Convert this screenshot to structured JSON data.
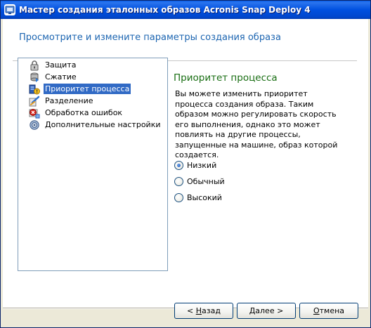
{
  "window": {
    "title": "Мастер создания эталонных образов Acronis Snap Deploy 4"
  },
  "header": {
    "title": "Просмотрите и измените параметры создания образа"
  },
  "tree": {
    "items": [
      {
        "label": "Защита",
        "icon": "lock-icon",
        "selected": false
      },
      {
        "label": "Сжатие",
        "icon": "compression-icon",
        "selected": false
      },
      {
        "label": "Приоритет процесса",
        "icon": "priority-icon",
        "selected": true
      },
      {
        "label": "Разделение",
        "icon": "split-icon",
        "selected": false
      },
      {
        "label": "Обработка ошибок",
        "icon": "error-handling-icon",
        "selected": false
      },
      {
        "label": "Дополнительные настройки",
        "icon": "settings-gear-icon",
        "selected": false
      }
    ]
  },
  "detail": {
    "title": "Приоритет процесса",
    "description": "Вы можете изменить приоритет процесса создания образа. Таким образом можно регулировать скорость его выполнения, однако это может повлиять на другие процессы, запущенные на машине, образ которой создается.",
    "options": [
      {
        "label": "Низкий",
        "checked": true
      },
      {
        "label": "Обычный",
        "checked": false
      },
      {
        "label": "Высокий",
        "checked": false
      }
    ]
  },
  "buttons": {
    "back": {
      "prefix": "< ",
      "accel": "Н",
      "rest": "азад"
    },
    "next": {
      "accel": "Д",
      "rest": "алее >"
    },
    "cancel": {
      "accel": "О",
      "rest": "тмена"
    }
  },
  "colors": {
    "header_title": "#1c65b1",
    "detail_title": "#196e13",
    "selection": "#316ac5",
    "titlebar": "#0050e0"
  }
}
